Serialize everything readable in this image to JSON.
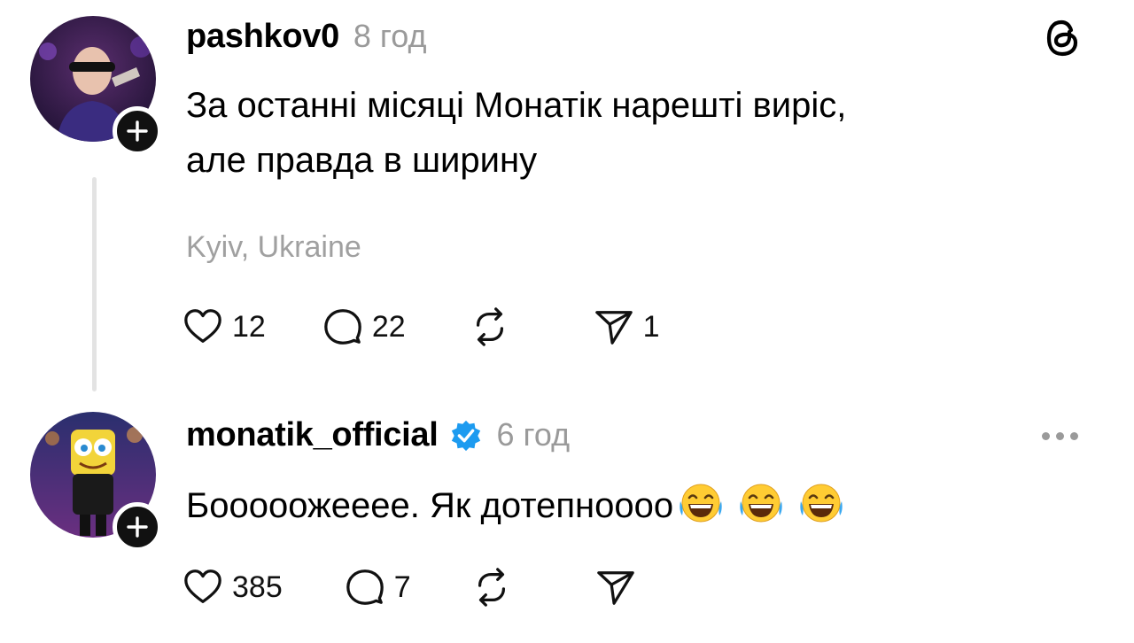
{
  "posts": [
    {
      "username": "pashkov0",
      "time": "8 год",
      "text_lines": [
        "За останні місяці Монатік нарешті виріс,",
        "але правда в ширину"
      ],
      "location": "Kyiv, Ukraine",
      "likes": "12",
      "replies": "22",
      "shares": "1"
    },
    {
      "username": "monatik_official",
      "verified": true,
      "time": "6 год",
      "text": "Бооооожееее. Як дотепнoooo",
      "emoji": [
        "face-with-tears-of-joy",
        "face-with-tears-of-joy",
        "face-with-tears-of-joy"
      ],
      "likes": "385",
      "replies": "7"
    }
  ],
  "icons": {
    "app_logo": "threads-logo-icon",
    "like": "heart-icon",
    "reply": "comment-icon",
    "repost": "repost-icon",
    "share": "send-icon",
    "more": "more-icon"
  },
  "colors": {
    "verified": "#1d9bf0",
    "muted_text": "#9a9a9a",
    "thread_line": "#e3e3e3"
  }
}
